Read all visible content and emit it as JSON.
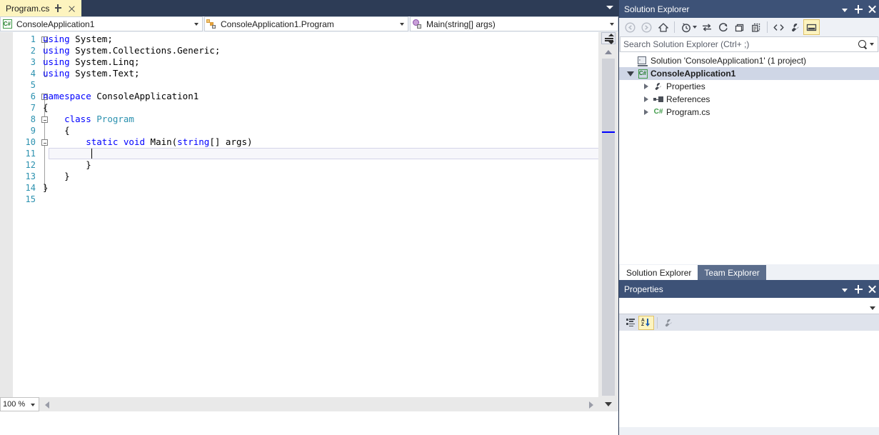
{
  "editor": {
    "tab": {
      "title": "Program.cs",
      "pin_icon": "pin-icon",
      "close_icon": "close-icon"
    },
    "navbar": {
      "project_combo": {
        "icon": "csharp-file-icon",
        "value": "ConsoleApplication1"
      },
      "type_combo": {
        "icon": "class-icon",
        "value": "ConsoleApplication1.Program"
      },
      "member_combo": {
        "icon": "method-icon",
        "value": "Main(string[] args)"
      }
    },
    "zoom": "100 %",
    "lines": [
      {
        "n": "1",
        "tokens": [
          {
            "t": "using",
            "c": "kw"
          },
          {
            "t": " System;",
            "c": "pln"
          }
        ]
      },
      {
        "n": "2",
        "tokens": [
          {
            "t": "using",
            "c": "kw"
          },
          {
            "t": " System.Collections.Generic;",
            "c": "pln"
          }
        ]
      },
      {
        "n": "3",
        "tokens": [
          {
            "t": "using",
            "c": "kw"
          },
          {
            "t": " System.Linq;",
            "c": "pln"
          }
        ]
      },
      {
        "n": "4",
        "tokens": [
          {
            "t": "using",
            "c": "kw"
          },
          {
            "t": " System.Text;",
            "c": "pln"
          }
        ]
      },
      {
        "n": "5",
        "tokens": []
      },
      {
        "n": "6",
        "tokens": [
          {
            "t": "namespace",
            "c": "kw"
          },
          {
            "t": " ConsoleApplication1",
            "c": "pln"
          }
        ]
      },
      {
        "n": "7",
        "tokens": [
          {
            "t": "{",
            "c": "pln"
          }
        ]
      },
      {
        "n": "8",
        "tokens": [
          {
            "t": "    ",
            "c": "pln"
          },
          {
            "t": "class",
            "c": "kw"
          },
          {
            "t": " ",
            "c": "pln"
          },
          {
            "t": "Program",
            "c": "typ"
          }
        ]
      },
      {
        "n": "9",
        "tokens": [
          {
            "t": "    {",
            "c": "pln"
          }
        ]
      },
      {
        "n": "10",
        "tokens": [
          {
            "t": "        ",
            "c": "pln"
          },
          {
            "t": "static",
            "c": "kw"
          },
          {
            "t": " ",
            "c": "pln"
          },
          {
            "t": "void",
            "c": "kw"
          },
          {
            "t": " Main(",
            "c": "pln"
          },
          {
            "t": "string",
            "c": "kw"
          },
          {
            "t": "[] args)",
            "c": "pln"
          }
        ]
      },
      {
        "n": "11",
        "tokens": [
          {
            "t": "        {",
            "c": "pln"
          }
        ]
      },
      {
        "n": "12",
        "tokens": [
          {
            "t": "        }",
            "c": "pln"
          }
        ]
      },
      {
        "n": "13",
        "tokens": [
          {
            "t": "    }",
            "c": "pln"
          }
        ]
      },
      {
        "n": "14",
        "tokens": [
          {
            "t": "}",
            "c": "pln"
          }
        ]
      },
      {
        "n": "15",
        "tokens": []
      }
    ],
    "current_line": 11
  },
  "solution_explorer": {
    "title": "Solution Explorer",
    "titlebar_buttons": [
      "window-menu-icon",
      "pin-icon",
      "close-icon"
    ],
    "toolbar": [
      {
        "name": "back-button",
        "icon": "back-arrow-icon",
        "disabled": true
      },
      {
        "name": "forward-button",
        "icon": "forward-arrow-icon",
        "disabled": true
      },
      {
        "name": "home-button",
        "icon": "home-icon",
        "disabled": false
      },
      {
        "name": "pending-changes-button",
        "icon": "clock-icon",
        "disabled": false
      },
      {
        "name": "sync-with-active-document-button",
        "icon": "sync-arrows-icon",
        "disabled": false
      },
      {
        "name": "refresh-button",
        "icon": "refresh-icon",
        "disabled": false
      },
      {
        "name": "collapse-all-button",
        "icon": "collapse-all-icon",
        "disabled": false
      },
      {
        "name": "show-all-files-button",
        "icon": "show-all-files-icon",
        "disabled": false
      },
      {
        "name": "view-code-button",
        "icon": "code-brackets-icon",
        "disabled": false
      },
      {
        "name": "properties-button",
        "icon": "wrench-icon",
        "disabled": false
      },
      {
        "name": "preview-selected-items-button",
        "icon": "preview-pane-icon",
        "selected": true
      }
    ],
    "search": {
      "placeholder": "Search Solution Explorer (Ctrl+ ;)",
      "value": "",
      "icon": "search-icon"
    },
    "tree": [
      {
        "label": "Solution 'ConsoleApplication1' (1 project)",
        "icon": "solution-icon",
        "depth": 0,
        "expander": "none",
        "bold": false,
        "selected": false
      },
      {
        "label": "ConsoleApplication1",
        "icon": "csharp-project-icon",
        "depth": 0,
        "expander": "open",
        "bold": true,
        "selected": true
      },
      {
        "label": "Properties",
        "icon": "wrench-icon",
        "depth": 1,
        "expander": "closed",
        "bold": false,
        "selected": false
      },
      {
        "label": "References",
        "icon": "references-icon",
        "depth": 1,
        "expander": "closed",
        "bold": false,
        "selected": false
      },
      {
        "label": "Program.cs",
        "icon": "csharp-file-icon",
        "depth": 1,
        "expander": "closed",
        "bold": false,
        "selected": false
      }
    ],
    "tabs": [
      {
        "label": "Solution Explorer",
        "active": true
      },
      {
        "label": "Team Explorer",
        "active": false
      }
    ]
  },
  "properties": {
    "title": "Properties",
    "titlebar_buttons": [
      "window-menu-icon",
      "pin-icon",
      "close-icon"
    ],
    "object_combo_value": "",
    "toolbar": [
      {
        "name": "categorized-button",
        "icon": "categorized-icon",
        "selected": false
      },
      {
        "name": "alphabetical-button",
        "icon": "alphabetical-sort-icon",
        "selected": true
      },
      {
        "name": "property-pages-button",
        "icon": "wrench-icon",
        "selected": false
      }
    ]
  },
  "colors": {
    "titlebar_bg": "#3d5277",
    "tabstrip_bg": "#2d3c56",
    "active_tab_bg": "#fdf4bf",
    "selection_bg": "#cfd6e6",
    "keyword": "#0000ff",
    "type": "#2b91af",
    "linenumber": "#2b91af",
    "toolbar_selected": "#fdf4bf"
  }
}
